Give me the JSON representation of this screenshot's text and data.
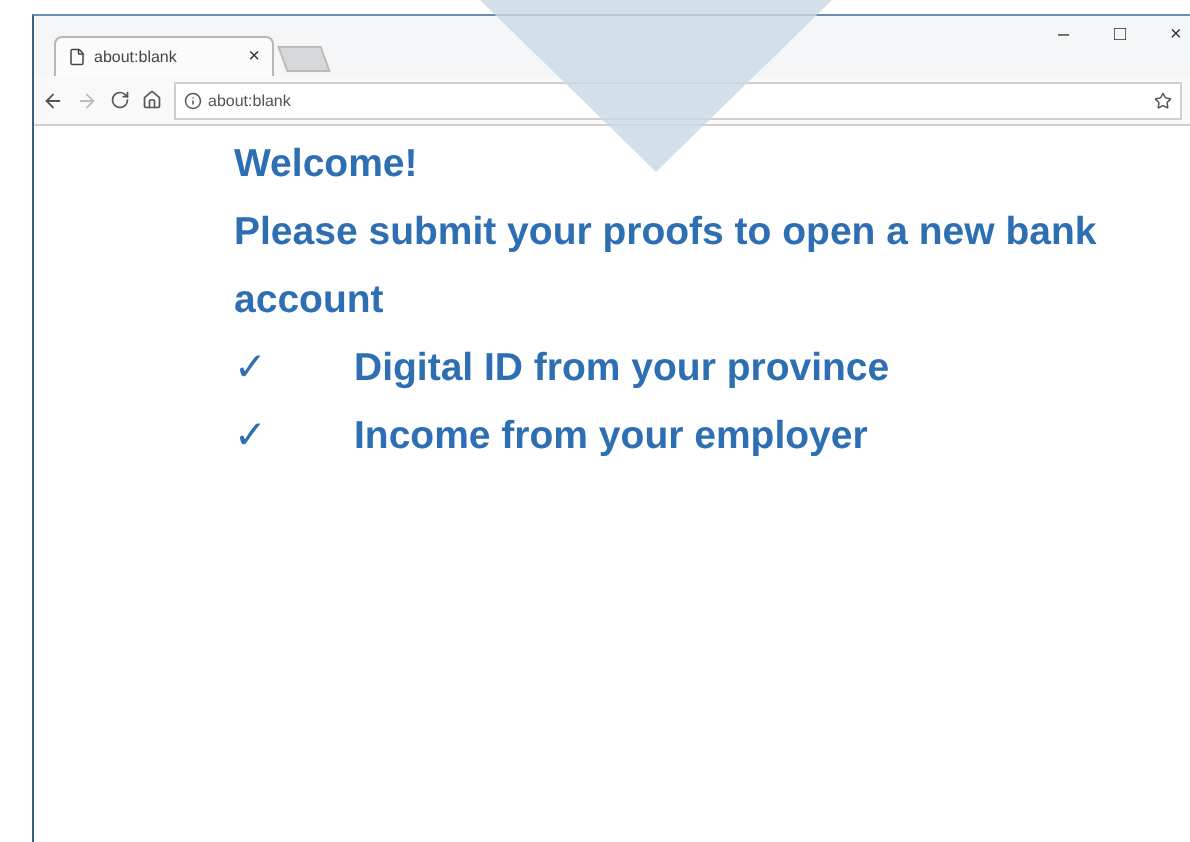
{
  "tab": {
    "title": "about:blank",
    "close": "×"
  },
  "window_controls": [
    "–",
    "□",
    "×"
  ],
  "address_bar": {
    "value": "about:blank"
  },
  "content": {
    "heading": "Welcome!",
    "paragraph": "Please submit your proofs to open a new bank account",
    "items": [
      {
        "marker": "✓",
        "text": "Digital ID from your province"
      },
      {
        "marker": "✓",
        "text": "Income from your employer"
      }
    ]
  }
}
